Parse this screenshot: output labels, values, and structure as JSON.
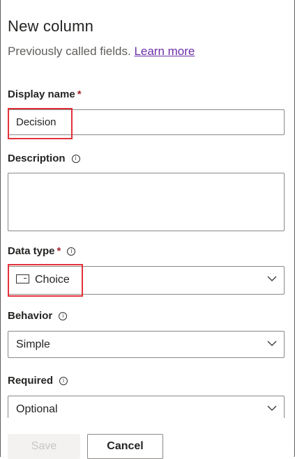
{
  "panel": {
    "title": "New column",
    "subtitle": "Previously called fields.",
    "learn_more": "Learn more"
  },
  "fields": {
    "display_name": {
      "label": "Display name",
      "required_mark": "*",
      "value": "Decision"
    },
    "description": {
      "label": "Description",
      "value": ""
    },
    "data_type": {
      "label": "Data type",
      "required_mark": "*",
      "value": "Choice",
      "icon": "choice-icon"
    },
    "behavior": {
      "label": "Behavior",
      "value": "Simple"
    },
    "required": {
      "label": "Required",
      "value": "Optional"
    }
  },
  "info_icon_glyph": "i",
  "footer": {
    "save_label": "Save",
    "cancel_label": "Cancel"
  },
  "colors": {
    "required_asterisk": "#a4262c",
    "link": "#6b2fa5",
    "highlight_box": "#e2323a",
    "border": "#8a8886",
    "disabled_text": "#c8c6c4"
  }
}
